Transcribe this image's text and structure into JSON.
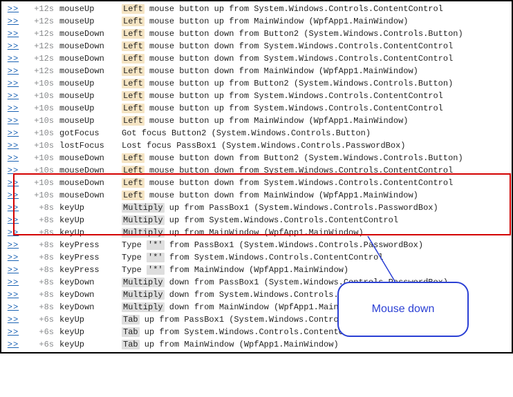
{
  "link_symbol": ">>",
  "callout": "Mouse down",
  "tags": {
    "left": "Left",
    "multiply": "Multiply",
    "star": "'*'",
    "tab": "Tab"
  },
  "rows": [
    {
      "time": "+12s",
      "event": "mouseUp",
      "tag": "left",
      "pre": "",
      "post": " mouse button up from System.Windows.Controls.ContentControl"
    },
    {
      "time": "+12s",
      "event": "mouseUp",
      "tag": "left",
      "pre": "",
      "post": " mouse button up from MainWindow (WpfApp1.MainWindow)"
    },
    {
      "time": "+12s",
      "event": "mouseDown",
      "tag": "left",
      "pre": "",
      "post": " mouse button down from Button2 (System.Windows.Controls.Button)"
    },
    {
      "time": "+12s",
      "event": "mouseDown",
      "tag": "left",
      "pre": "",
      "post": " mouse button down from System.Windows.Controls.ContentControl"
    },
    {
      "time": "+12s",
      "event": "mouseDown",
      "tag": "left",
      "pre": "",
      "post": " mouse button down from System.Windows.Controls.ContentControl"
    },
    {
      "time": "+12s",
      "event": "mouseDown",
      "tag": "left",
      "pre": "",
      "post": " mouse button down from MainWindow (WpfApp1.MainWindow)"
    },
    {
      "time": "+10s",
      "event": "mouseUp",
      "tag": "left",
      "pre": "",
      "post": " mouse button up from Button2 (System.Windows.Controls.Button)"
    },
    {
      "time": "+10s",
      "event": "mouseUp",
      "tag": "left",
      "pre": "",
      "post": " mouse button up from System.Windows.Controls.ContentControl"
    },
    {
      "time": "+10s",
      "event": "mouseUp",
      "tag": "left",
      "pre": "",
      "post": " mouse button up from System.Windows.Controls.ContentControl"
    },
    {
      "time": "+10s",
      "event": "mouseUp",
      "tag": "left",
      "pre": "",
      "post": " mouse button up from MainWindow (WpfApp1.MainWindow)"
    },
    {
      "time": "+10s",
      "event": "gotFocus",
      "tag": null,
      "pre": "Got focus Button2 (System.Windows.Controls.Button)",
      "post": ""
    },
    {
      "time": "+10s",
      "event": "lostFocus",
      "tag": null,
      "pre": "Lost focus PassBox1 (System.Windows.Controls.PasswordBox)",
      "post": ""
    },
    {
      "time": "+10s",
      "event": "mouseDown",
      "tag": "left",
      "pre": "",
      "post": " mouse button down from Button2 (System.Windows.Controls.Button)"
    },
    {
      "time": "+10s",
      "event": "mouseDown",
      "tag": "left",
      "pre": "",
      "post": " mouse button down from System.Windows.Controls.ContentControl"
    },
    {
      "time": "+10s",
      "event": "mouseDown",
      "tag": "left",
      "pre": "",
      "post": " mouse button down from System.Windows.Controls.ContentControl"
    },
    {
      "time": "+10s",
      "event": "mouseDown",
      "tag": "left",
      "pre": "",
      "post": " mouse button down from MainWindow (WpfApp1.MainWindow)"
    },
    {
      "time": "+8s",
      "event": "keyUp",
      "tag": "multiply",
      "pre": "",
      "post": " up from PassBox1 (System.Windows.Controls.PasswordBox)"
    },
    {
      "time": "+8s",
      "event": "keyUp",
      "tag": "multiply",
      "pre": "",
      "post": " up from System.Windows.Controls.ContentControl"
    },
    {
      "time": "+8s",
      "event": "keyUp",
      "tag": "multiply",
      "pre": "",
      "post": " up from MainWindow (WpfApp1.MainWindow)"
    },
    {
      "time": "+8s",
      "event": "keyPress",
      "tag": "star",
      "pre": "Type ",
      "post": " from PassBox1 (System.Windows.Controls.PasswordBox)"
    },
    {
      "time": "+8s",
      "event": "keyPress",
      "tag": "star",
      "pre": "Type ",
      "post": " from System.Windows.Controls.ContentControl"
    },
    {
      "time": "+8s",
      "event": "keyPress",
      "tag": "star",
      "pre": "Type ",
      "post": " from MainWindow (WpfApp1.MainWindow)"
    },
    {
      "time": "+8s",
      "event": "keyDown",
      "tag": "multiply",
      "pre": "",
      "post": " down from PassBox1 (System.Windows.Controls.PasswordBox)"
    },
    {
      "time": "+8s",
      "event": "keyDown",
      "tag": "multiply",
      "pre": "",
      "post": " down from System.Windows.Controls.ContentControl"
    },
    {
      "time": "+8s",
      "event": "keyDown",
      "tag": "multiply",
      "pre": "",
      "post": " down from MainWindow (WpfApp1.MainWindow)"
    },
    {
      "time": "+6s",
      "event": "keyUp",
      "tag": "tab",
      "pre": "",
      "post": " up from PassBox1 (System.Windows.Controls.PasswordBox)"
    },
    {
      "time": "+6s",
      "event": "keyUp",
      "tag": "tab",
      "pre": "",
      "post": " up from System.Windows.Controls.ContentControl"
    },
    {
      "time": "+6s",
      "event": "keyUp",
      "tag": "tab",
      "pre": "",
      "post": " up from MainWindow (WpfApp1.MainWindow)"
    }
  ]
}
